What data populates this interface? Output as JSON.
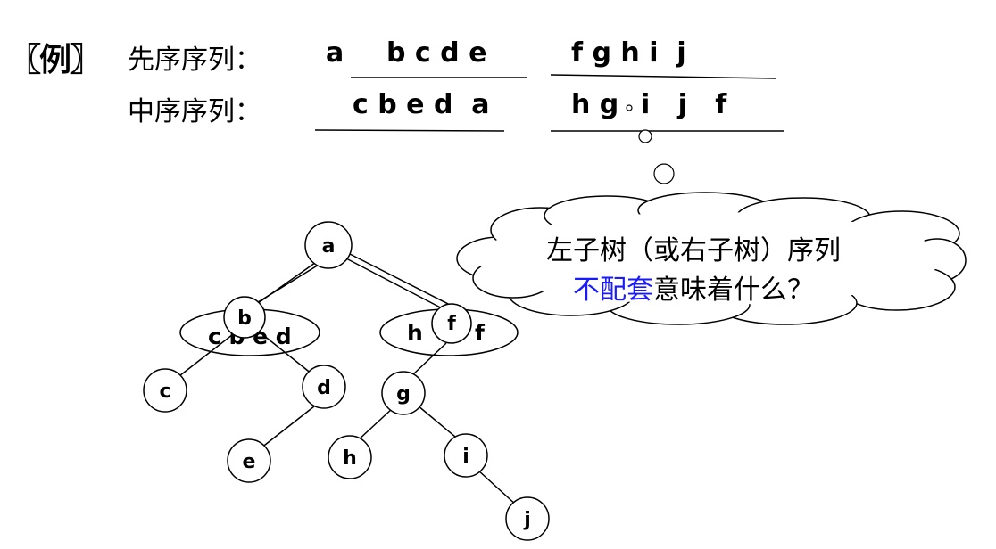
{
  "example_tag": "〖例〗",
  "preorder": {
    "label": "先序序列：",
    "root": "a",
    "left": "b c d e",
    "right": "f g h i  j"
  },
  "inorder": {
    "label": "中序序列：",
    "left": "c b e d  a",
    "right_part1": "h g",
    "right_part2": "i   j   f"
  },
  "tree": {
    "nodes": {
      "a": "a",
      "b": "b",
      "c": "c",
      "d": "d",
      "e": "e",
      "f": "f",
      "g": "g",
      "h": "h",
      "i": "i",
      "j": "j"
    },
    "left_group": "c b e d",
    "right_group_h": "h",
    "right_group_f": "f"
  },
  "callout": {
    "line1": "左子树（或右子树）序列",
    "line2_highlight": "不配套",
    "line2_rest": "意味着什么？"
  },
  "colors": {
    "highlight": "#1a1aff",
    "ink": "#000000"
  }
}
